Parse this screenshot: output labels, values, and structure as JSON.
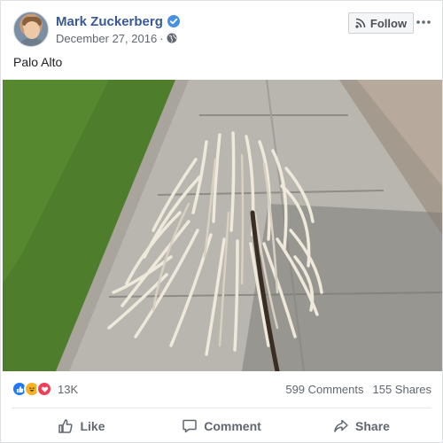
{
  "author": {
    "name": "Mark Zuckerberg",
    "verified": true,
    "date": "December 27, 2016",
    "separator": "·",
    "audience_icon": "globe-icon"
  },
  "follow": {
    "label": "Follow",
    "icon": "rss-icon"
  },
  "post": {
    "text": "Palo Alto"
  },
  "stats": {
    "reactions": [
      "like",
      "haha",
      "love"
    ],
    "reaction_count": "13K",
    "comments": "599 Comments",
    "shares": "155 Shares"
  },
  "actions": {
    "like_label": "Like",
    "comment_label": "Comment",
    "share_label": "Share"
  },
  "colors": {
    "name_link": "#385898",
    "like": "#2078f4",
    "haha": "#f7b125",
    "love": "#f33e58",
    "meta_text": "#606770"
  }
}
